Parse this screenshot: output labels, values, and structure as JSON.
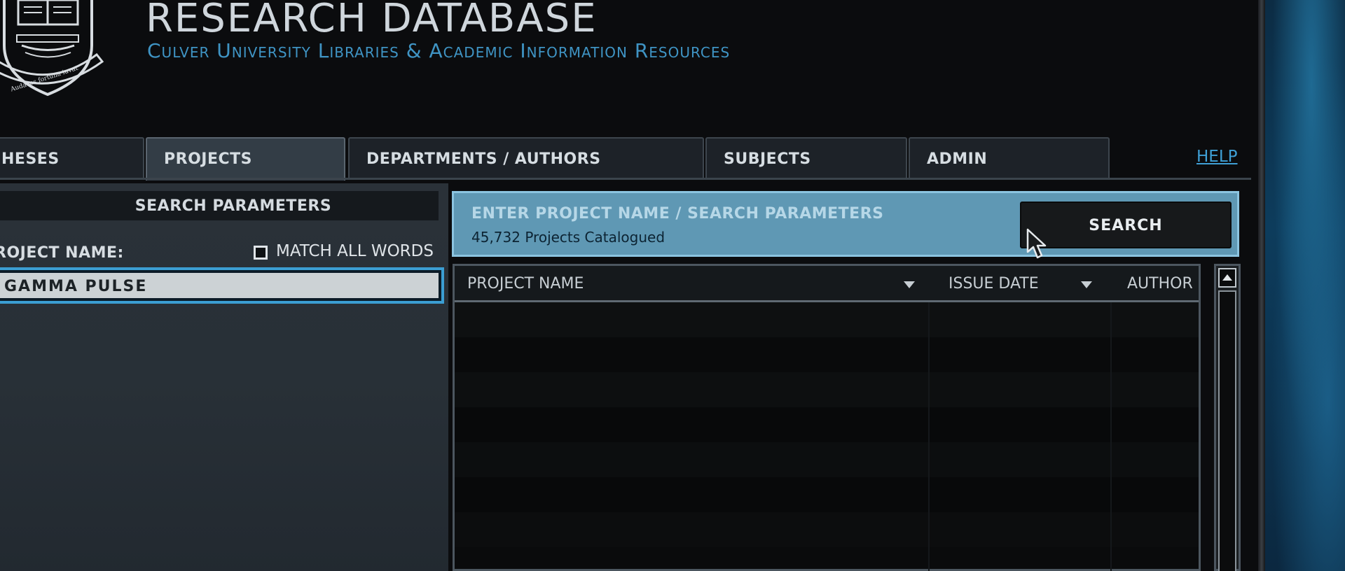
{
  "header": {
    "title": "RESEARCH DATABASE",
    "subtitle": "Culver University Libraries & Academic Information Resources",
    "logo_icon": "university-crest",
    "logo_motto": "Audaces fortuna iuvat"
  },
  "tabs": [
    {
      "label": "HESES",
      "active": false
    },
    {
      "label": "PROJECTS",
      "active": true
    },
    {
      "label": "DEPARTMENTS / AUTHORS",
      "active": false
    },
    {
      "label": "SUBJECTS",
      "active": false
    },
    {
      "label": "ADMIN",
      "active": false
    }
  ],
  "help_label": "HELP",
  "search_params": {
    "header": "SEARCH PARAMETERS",
    "project_name_label": "ROJECT NAME:",
    "match_all_words_label": "MATCH ALL WORDS",
    "match_all_words_checked": false,
    "project_name_value": "GAMMA PULSE"
  },
  "search_banner": {
    "title": "ENTER PROJECT NAME / SEARCH PARAMETERS",
    "count_text": "45,732 Projects Catalogued",
    "search_label": "SEARCH"
  },
  "results": {
    "columns": [
      "PROJECT NAME",
      "ISSUE DATE",
      "AUTHOR"
    ],
    "rows": []
  },
  "colors": {
    "accent_blue": "#3b9ed3",
    "banner_blue": "#5f98b4",
    "link_blue": "#3fa0d6"
  }
}
